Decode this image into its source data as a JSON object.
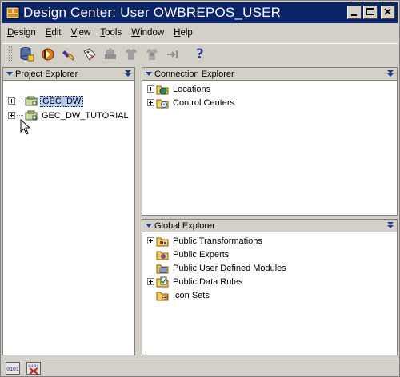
{
  "window": {
    "title": "Design Center: User OWBREPOS_USER"
  },
  "menu": [
    {
      "label": "Design",
      "mnemonic": "D",
      "rest": "esign"
    },
    {
      "label": "Edit",
      "mnemonic": "E",
      "rest": "dit"
    },
    {
      "label": "View",
      "mnemonic": "V",
      "rest": "iew"
    },
    {
      "label": "Tools",
      "mnemonic": "T",
      "rest": "ools"
    },
    {
      "label": "Window",
      "mnemonic": "W",
      "rest": "indow"
    },
    {
      "label": "Help",
      "mnemonic": "H",
      "rest": "elp"
    }
  ],
  "toolbar": {
    "icons": [
      "repository-icon",
      "deploy-icon",
      "search-flashlight-icon",
      "tag-icon",
      "gray-deploy-icon",
      "gray-shirt-icon",
      "gray-shirt2-icon",
      "gray-arrow-icon",
      "help-question-icon"
    ],
    "help_label": "?"
  },
  "project_explorer": {
    "title": "Project Explorer",
    "items": [
      {
        "label": "GEC_DW",
        "selected": true
      },
      {
        "label": "GEC_DW_TUTORIAL",
        "selected": false
      }
    ]
  },
  "connection_explorer": {
    "title": "Connection Explorer",
    "items": [
      {
        "label": "Locations"
      },
      {
        "label": "Control Centers"
      }
    ]
  },
  "global_explorer": {
    "title": "Global Explorer",
    "items": [
      {
        "label": "Public Transformations",
        "expandable": true
      },
      {
        "label": "Public Experts",
        "expandable": false
      },
      {
        "label": "Public User Defined Modules",
        "expandable": false
      },
      {
        "label": "Public Data Rules",
        "expandable": true
      },
      {
        "label": "Icon Sets",
        "expandable": false
      }
    ]
  },
  "colors": {
    "titlebar": "#0a246a",
    "panel_header": "#d4d0c8",
    "selection": "#b9cbf0"
  }
}
